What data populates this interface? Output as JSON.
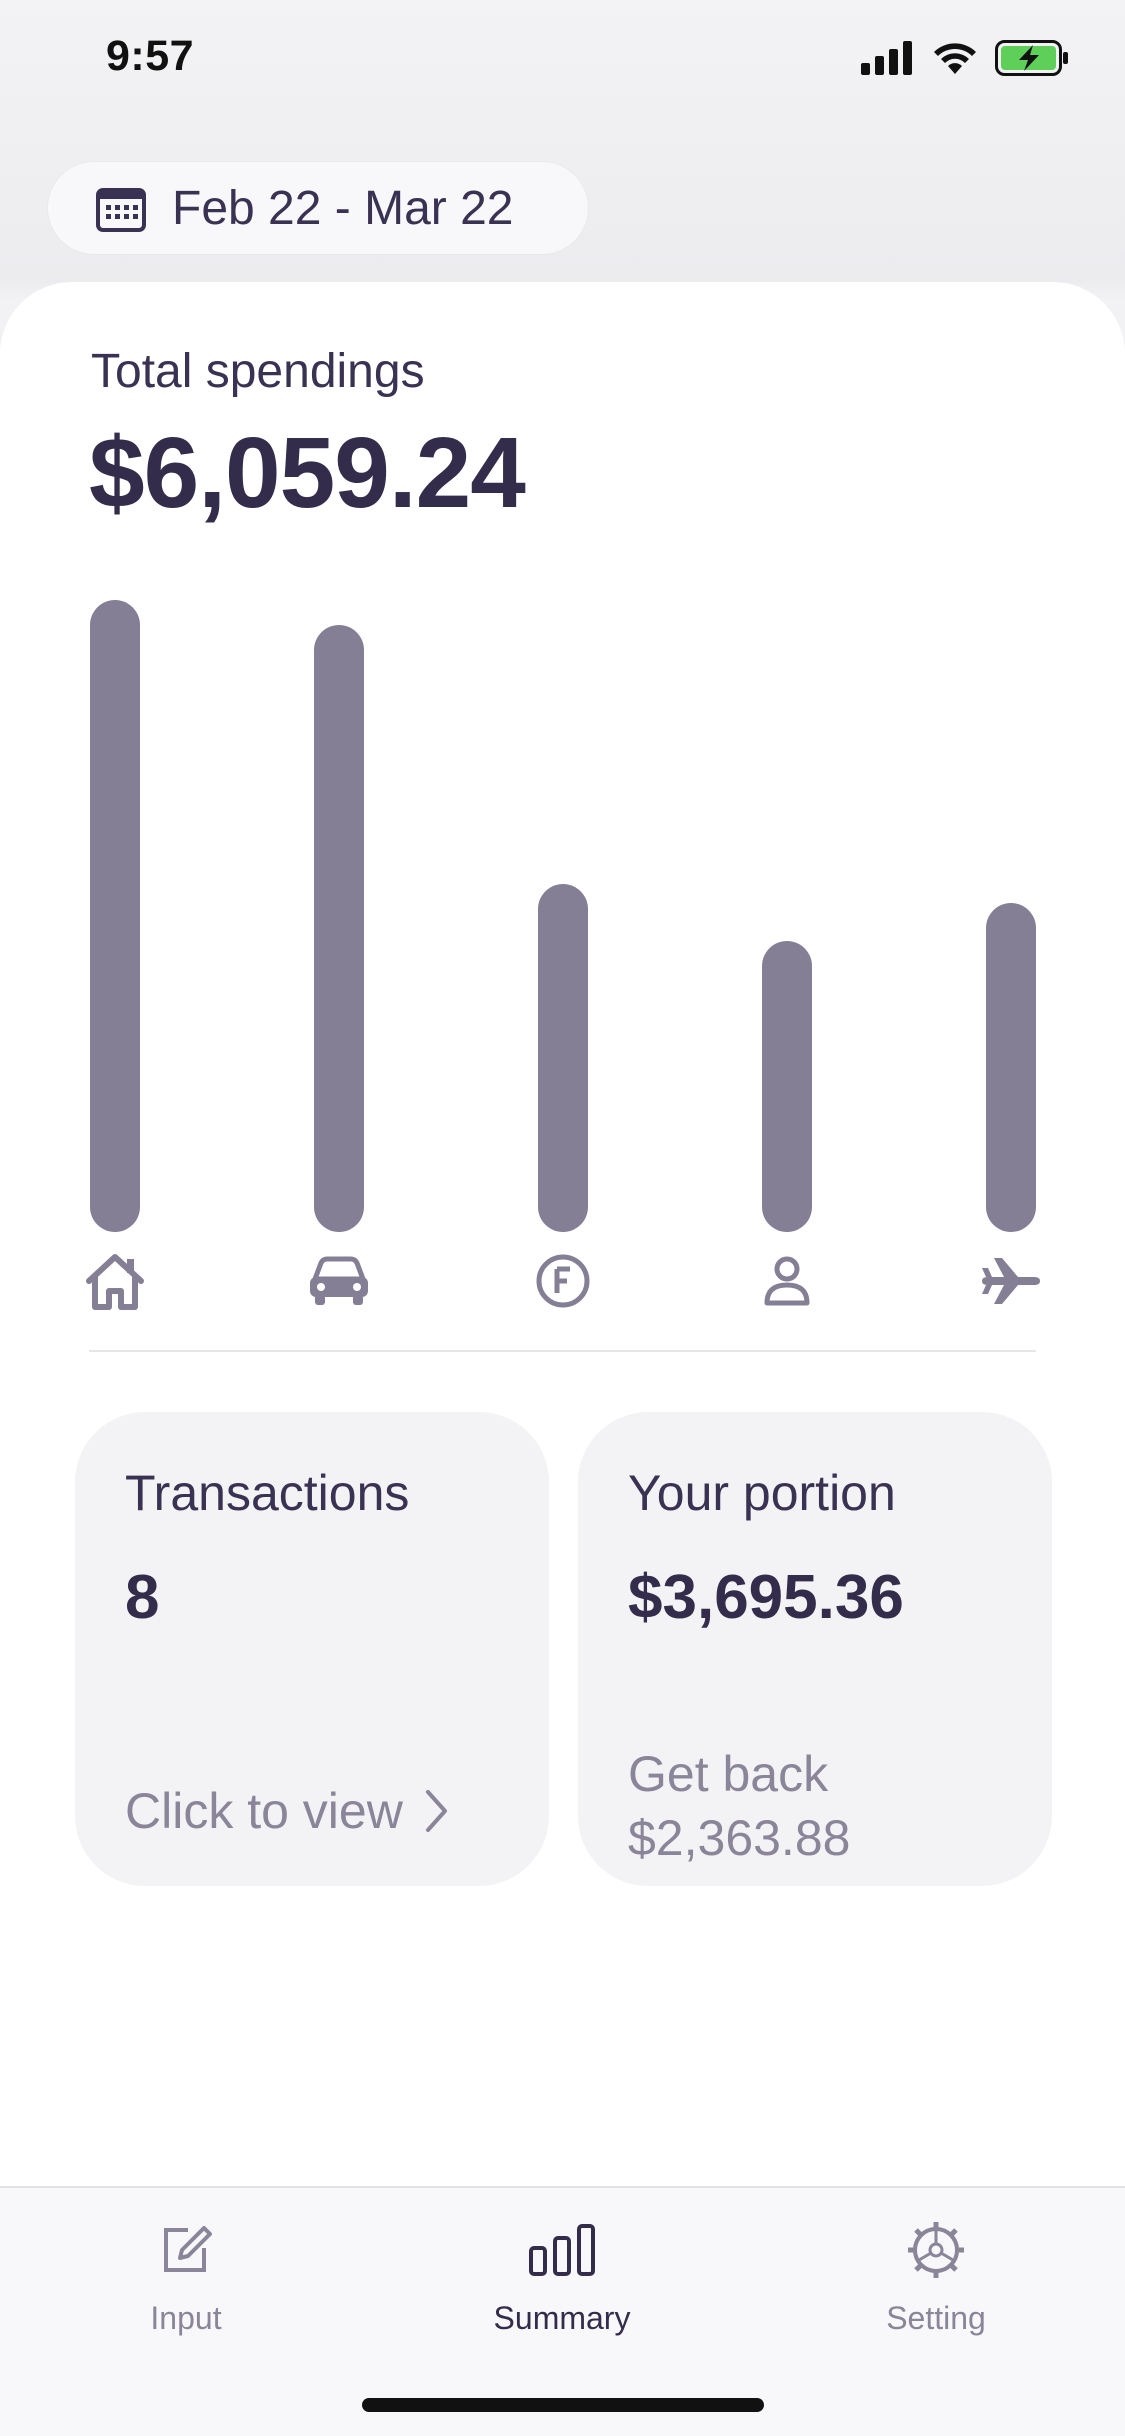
{
  "status": {
    "time": "9:57"
  },
  "date_range": {
    "label": "Feb 22 - Mar 22",
    "icon": "calendar-icon"
  },
  "summary": {
    "total_label": "Total spendings",
    "total_value": "$6,059.24"
  },
  "categories": [
    {
      "name": "home",
      "icon": "home-icon",
      "level": 1.0
    },
    {
      "name": "car",
      "icon": "car-icon",
      "level": 0.96
    },
    {
      "name": "food",
      "icon": "food-icon",
      "level": 0.55
    },
    {
      "name": "personal",
      "icon": "person-icon",
      "level": 0.46
    },
    {
      "name": "travel",
      "icon": "plane-icon",
      "level": 0.52
    }
  ],
  "tiles": {
    "transactions": {
      "label": "Transactions",
      "value": "8",
      "link": "Click to view"
    },
    "portion": {
      "label": "Your portion",
      "value": "$3,695.36",
      "sub_line1": "Get back",
      "sub_line2": "$2,363.88"
    }
  },
  "tabs": [
    {
      "label": "Input",
      "icon": "edit-icon",
      "active": false
    },
    {
      "label": "Summary",
      "icon": "bar-chart-icon",
      "active": true
    },
    {
      "label": "Setting",
      "icon": "gear-icon",
      "active": false
    }
  ],
  "colors": {
    "bar": "#857f95",
    "text_dark": "#342c4b",
    "muted": "#8a8598",
    "battery": "#5ed05a"
  }
}
